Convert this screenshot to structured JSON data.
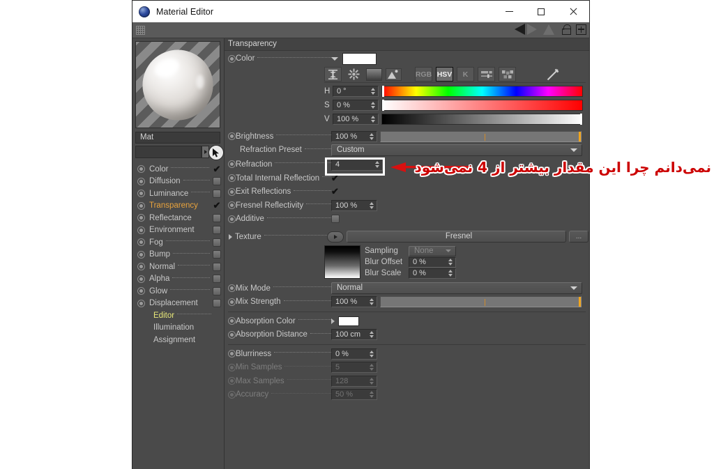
{
  "window": {
    "title": "Material Editor",
    "app_icon": "sphere-icon",
    "minimize_label": "—",
    "maximize_label": "□",
    "close_label": "✕"
  },
  "toolbar": {
    "grip": "drag-grip",
    "icons": [
      "triangle-left-icon",
      "triangle-right-icon",
      "triangle-up-icon",
      "lock-icon",
      "plus-icon"
    ]
  },
  "sidebar": {
    "preview_alt": "material-preview-sphere",
    "material_name": "Mat",
    "search_value": "",
    "channels": [
      {
        "label": "Color",
        "state": "checked",
        "enabled": true,
        "dotted": true
      },
      {
        "label": "Diffusion",
        "state": "unchecked",
        "enabled": true,
        "dotted": true
      },
      {
        "label": "Luminance",
        "state": "unchecked",
        "enabled": true,
        "dotted": true
      },
      {
        "label": "Transparency",
        "state": "checked",
        "enabled": true,
        "dotted": false,
        "active": true
      },
      {
        "label": "Reflectance",
        "state": "unchecked",
        "enabled": true,
        "dotted": false
      },
      {
        "label": "Environment",
        "state": "unchecked",
        "enabled": true,
        "dotted": false
      },
      {
        "label": "Fog",
        "state": "unchecked",
        "enabled": true,
        "dotted": true
      },
      {
        "label": "Bump",
        "state": "unchecked",
        "enabled": true,
        "dotted": true
      },
      {
        "label": "Normal",
        "state": "unchecked",
        "enabled": true,
        "dotted": true
      },
      {
        "label": "Alpha",
        "state": "unchecked",
        "enabled": true,
        "dotted": true
      },
      {
        "label": "Glow",
        "state": "unchecked",
        "enabled": true,
        "dotted": true
      },
      {
        "label": "Displacement",
        "state": "unchecked",
        "enabled": true,
        "dotted": false
      }
    ],
    "sub_items": [
      {
        "label": "Editor",
        "highlight": true,
        "dotted": true
      },
      {
        "label": "Illumination",
        "highlight": false,
        "dotted": false
      },
      {
        "label": "Assignment",
        "highlight": false,
        "dotted": false
      }
    ]
  },
  "panel": {
    "section_title": "Transparency",
    "color": {
      "label": "Color",
      "swatch_hex": "#FFFFFF",
      "mode_buttons": [
        {
          "id": "range-icon",
          "label": "",
          "selected": false
        },
        {
          "id": "wheel-icon",
          "label": "",
          "selected": false
        },
        {
          "id": "gradient-icon",
          "label": "",
          "selected": false
        },
        {
          "id": "image-icon",
          "label": "",
          "selected": false
        },
        {
          "id": "rgb-button",
          "label": "RGB",
          "selected": false
        },
        {
          "id": "hsv-button",
          "label": "HSV",
          "selected": true
        },
        {
          "id": "k-button",
          "label": "K",
          "selected": false
        },
        {
          "id": "sliders-icon",
          "label": "",
          "selected": false
        },
        {
          "id": "swatches-icon",
          "label": "",
          "selected": false
        },
        {
          "id": "eyedropper-icon",
          "label": "",
          "selected": false
        }
      ],
      "hsv": [
        {
          "label": "H",
          "value": "0 °",
          "knob_pct": 0
        },
        {
          "label": "S",
          "value": "0 %",
          "knob_pct": 0
        },
        {
          "label": "V",
          "value": "100 %",
          "knob_pct": 100
        }
      ]
    },
    "rows": {
      "brightness": {
        "label": "Brightness",
        "value": "100 %",
        "slider_pct": 100
      },
      "refraction_preset": {
        "label": "Refraction Preset",
        "value": "Custom"
      },
      "refraction": {
        "label": "Refraction",
        "value": "4"
      },
      "total_internal_reflection": {
        "label": "Total Internal Reflection",
        "checked": true
      },
      "exit_reflections": {
        "label": "Exit Reflections",
        "checked": true
      },
      "fresnel_reflectivity": {
        "label": "Fresnel Reflectivity",
        "value": "100 %"
      },
      "additive": {
        "label": "Additive",
        "checked": false
      },
      "texture": {
        "label": "Texture",
        "value": "Fresnel",
        "more_label": "..."
      },
      "sampling": {
        "label": "Sampling",
        "value": "None"
      },
      "blur_offset": {
        "label": "Blur Offset",
        "value": "0 %"
      },
      "blur_scale": {
        "label": "Blur Scale",
        "value": "0 %"
      },
      "mix_mode": {
        "label": "Mix Mode",
        "value": "Normal"
      },
      "mix_strength": {
        "label": "Mix Strength",
        "value": "100 %",
        "slider_pct": 100
      },
      "absorption_color": {
        "label": "Absorption Color",
        "swatch_hex": "#FFFFFF"
      },
      "absorption_distance": {
        "label": "Absorption Distance",
        "value": "100 cm"
      },
      "blurriness": {
        "label": "Blurriness",
        "value": "0 %"
      },
      "min_samples": {
        "label": "Min Samples",
        "value": "5",
        "disabled": true
      },
      "max_samples": {
        "label": "Max Samples",
        "value": "128",
        "disabled": true
      },
      "accuracy": {
        "label": "Accuracy",
        "value": "50 %",
        "disabled": true
      }
    }
  },
  "annotation": {
    "text": "نمی‌دانم چرا این مقدار بیشتر از 4 نمی‌شود",
    "color": "#CC0000",
    "highlight_box_color": "#FFFFFF",
    "arrow": "arrow-left"
  }
}
